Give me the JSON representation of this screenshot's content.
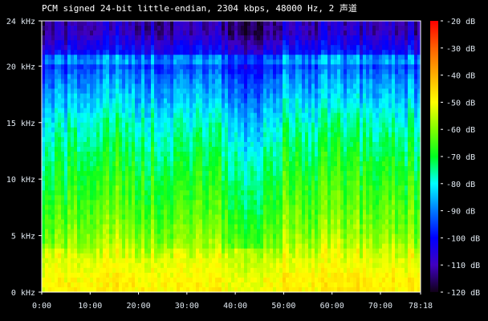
{
  "chart_data": {
    "type": "heatmap",
    "title": "PCM signed 24-bit little-endian, 2304 kbps, 48000 Hz, 2 声道",
    "xlabel": "",
    "ylabel": "",
    "xlim_minutes": [
      0,
      78.3
    ],
    "ylim_khz": [
      0,
      24
    ],
    "x_ticks": [
      "0:00",
      "10:00",
      "20:00",
      "30:00",
      "40:00",
      "50:00",
      "60:00",
      "70:00",
      "78:18"
    ],
    "x_tick_values_min": [
      0,
      10,
      20,
      30,
      40,
      50,
      60,
      70,
      78.3
    ],
    "y_ticks": [
      "0 kHz",
      "5 kHz",
      "10 kHz",
      "15 kHz",
      "20 kHz",
      "24 kHz"
    ],
    "y_tick_values_khz": [
      0,
      5,
      10,
      15,
      20,
      24
    ],
    "colorbar": {
      "ticks": [
        "-20 dB",
        "-30 dB",
        "-40 dB",
        "-50 dB",
        "-60 dB",
        "-70 dB",
        "-80 dB",
        "-90 dB",
        "-100 dB",
        "-110 dB",
        "-120 dB"
      ],
      "values": [
        -20,
        -30,
        -40,
        -50,
        -60,
        -70,
        -80,
        -90,
        -100,
        -110,
        -120
      ],
      "range_db": [
        -120,
        -20
      ],
      "colors": [
        "#ff0000",
        "#ff6000",
        "#ffb000",
        "#ffff00",
        "#80ff00",
        "#00ff20",
        "#00ffff",
        "#0078ff",
        "#0000ff",
        "#4000c0",
        "#100018"
      ]
    },
    "band_profile_db_low_to_high_2khz": [
      -48,
      -52,
      -58,
      -62,
      -65,
      -68,
      -72,
      -76,
      -82,
      -88,
      -97,
      -108
    ],
    "time_segments_minutes": [
      0,
      5,
      10,
      15,
      20,
      25,
      30,
      35,
      40,
      45,
      50,
      55,
      60,
      65,
      70,
      75
    ],
    "time_offset_db": [
      -6,
      -2,
      0,
      0,
      -2,
      -5,
      0,
      -3,
      -13,
      -2,
      0,
      -1,
      0,
      -2,
      0,
      -3
    ]
  }
}
